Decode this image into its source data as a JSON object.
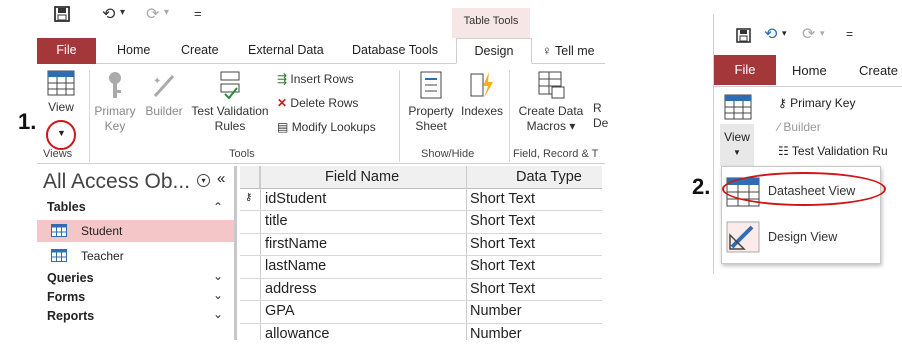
{
  "left": {
    "qat": {
      "save_icon": "save-icon",
      "undo": "⟲",
      "undo_dd": "▾",
      "redo": "⟳",
      "redo_dd": "▾",
      "customize": "="
    },
    "context_tab": "Table Tools",
    "tabs": [
      "File",
      "Home",
      "Create",
      "External Data",
      "Database Tools",
      "Design"
    ],
    "tell_me": "Tell me",
    "ribbon": {
      "view": "View",
      "primary_key": [
        "Primary",
        "Key"
      ],
      "builder": "Builder",
      "test_validation": [
        "Test Validation",
        "Rules"
      ],
      "insert_rows": "Insert Rows",
      "delete_rows": "Delete Rows",
      "modify_lookups": "Modify Lookups",
      "property_sheet": [
        "Property",
        "Sheet"
      ],
      "indexes": "Indexes",
      "create_data_macros": [
        "Create Data",
        "Macros ▾"
      ],
      "cut_d": [
        "R",
        "De"
      ],
      "groups": {
        "views": "Views",
        "tools": "Tools",
        "showhide": "Show/Hide",
        "field": "Field, Record & T"
      }
    },
    "nav": {
      "title": "All Access Ob...",
      "tables": "Tables",
      "items": [
        "Student",
        "Teacher"
      ],
      "queries": "Queries",
      "forms": "Forms",
      "reports": "Reports",
      "up_arrow": "⌃",
      "down_arrow": "⌄",
      "down_arrow2": "⌄",
      "down_arrow3": "⌄"
    },
    "grid": {
      "headers": [
        "Field Name",
        "Data Type"
      ],
      "rows": [
        [
          "idStudent",
          "Short Text"
        ],
        [
          "title",
          "Short Text"
        ],
        [
          "firstName",
          "Short Text"
        ],
        [
          "lastName",
          "Short Text"
        ],
        [
          "address",
          "Short Text"
        ],
        [
          "GPA",
          "Number"
        ],
        [
          "allowance",
          "Number"
        ]
      ]
    },
    "step_label": "1."
  },
  "right": {
    "file": "File",
    "home": "Home",
    "create": "Create",
    "view": "View",
    "primary_key": "Primary Key",
    "builder": "Builder",
    "test_validation": "Test Validation Ru",
    "menu": [
      "Datasheet View",
      "Design View"
    ],
    "step_label": "2."
  },
  "colors": {
    "file_red": "#a4373a",
    "highlight": "#f4c6c8",
    "annotation_red": "#d01515"
  }
}
